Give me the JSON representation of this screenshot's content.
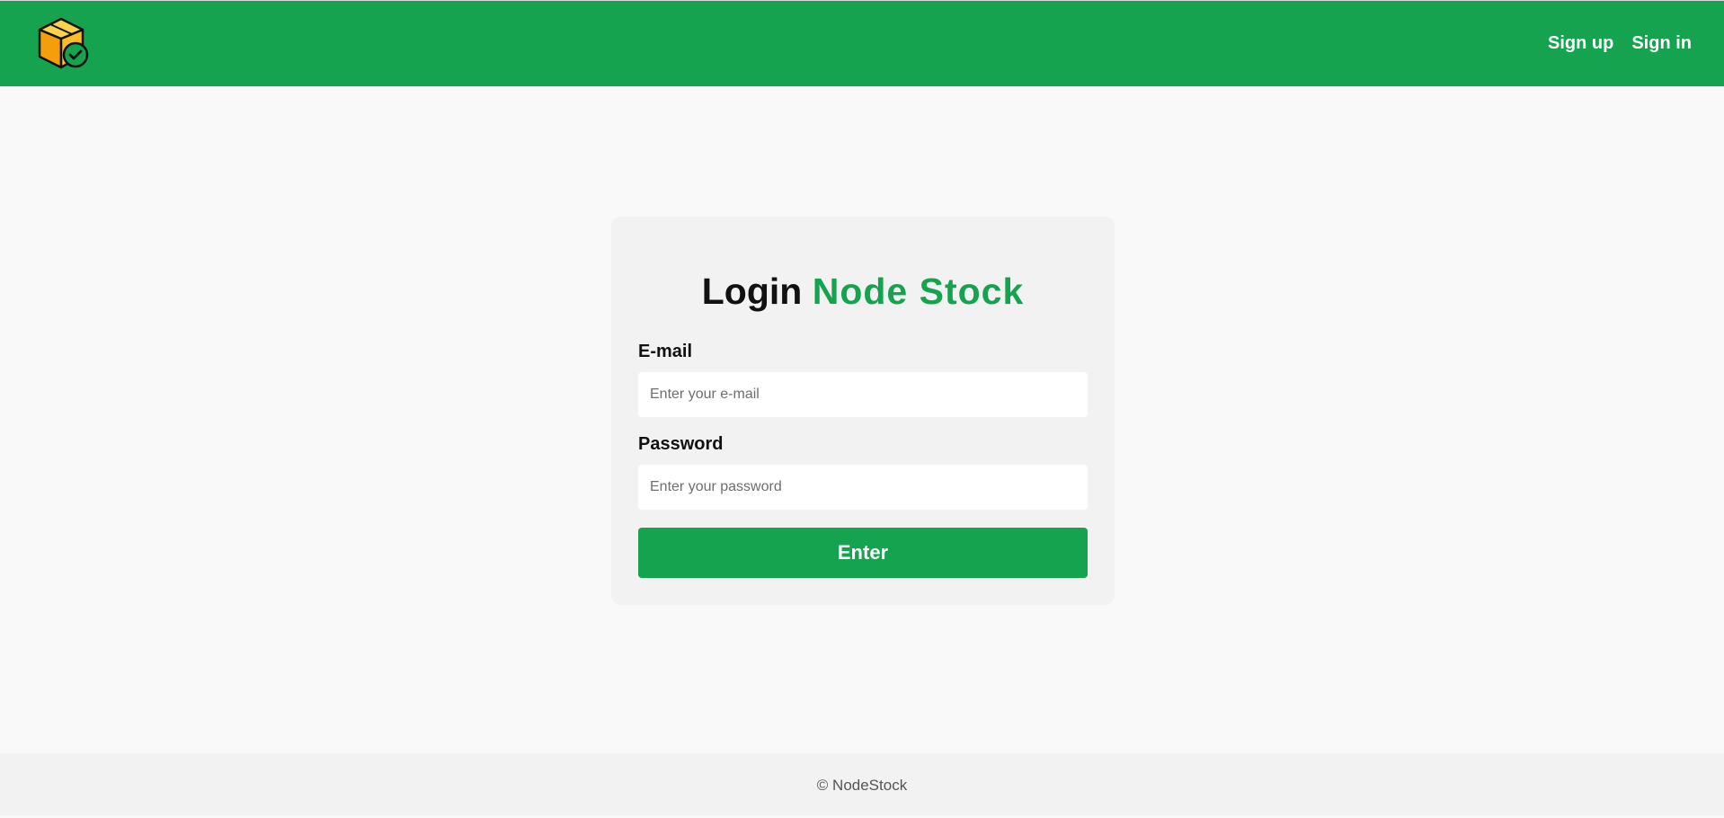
{
  "header": {
    "logo_icon": "package-check-icon",
    "nav": {
      "signup_label": "Sign up",
      "signin_label": "Sign in"
    },
    "background_color": "#16a34f"
  },
  "login": {
    "title_prefix": "Login",
    "title_brand": "Node Stock",
    "email": {
      "label": "E-mail",
      "placeholder": "Enter your e-mail",
      "value": ""
    },
    "password": {
      "label": "Password",
      "placeholder": "Enter your password",
      "value": ""
    },
    "submit_label": "Enter"
  },
  "footer": {
    "text": "© NodeStock"
  },
  "colors": {
    "brand_green": "#16a34f",
    "box_orange": "#f59e0b"
  }
}
